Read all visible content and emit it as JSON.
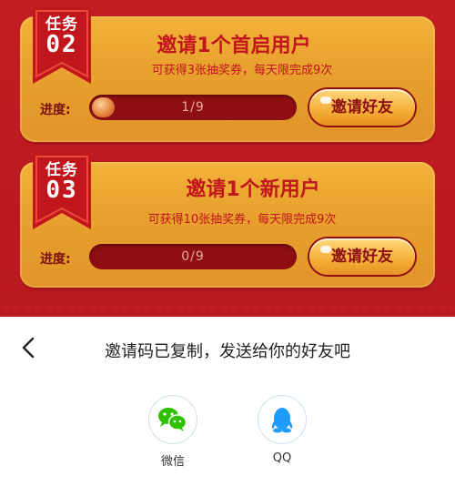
{
  "tasks": [
    {
      "badge_top": "任务",
      "badge_num": "02",
      "title": "邀请1个首启用户",
      "subtitle": "可获得3张抽奖券，每天限完成9次",
      "progress_label": "进度:",
      "progress_text": "1/9",
      "progress_fraction": 0.111,
      "button_label": "邀请好友"
    },
    {
      "badge_top": "任务",
      "badge_num": "03",
      "title": "邀请1个新用户",
      "subtitle": "可获得10张抽奖券，每天限完成9次",
      "progress_label": "进度:",
      "progress_text": "0/9",
      "progress_fraction": 0,
      "button_label": "邀请好友"
    }
  ],
  "share_sheet": {
    "back_icon": "chevron-left-icon",
    "title": "邀请码已复制，发送给你的好友吧",
    "targets": [
      {
        "label": "微信",
        "icon": "wechat-icon",
        "color": "#2dc100"
      },
      {
        "label": "QQ",
        "icon": "qq-icon",
        "color": "#1e9bff"
      }
    ]
  },
  "colors": {
    "background_red": "#b81a21",
    "card_gold": "#eaa232",
    "title_red": "#c0161c",
    "bar_dark": "#8e0f12"
  }
}
